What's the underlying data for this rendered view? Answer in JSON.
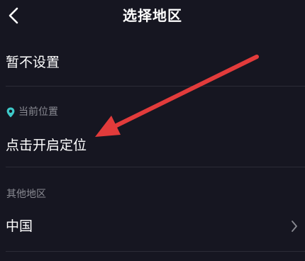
{
  "header": {
    "title": "选择地区"
  },
  "options": {
    "not_set_label": "暂不设置"
  },
  "current_location": {
    "section_label": "当前位置",
    "enable_label": "点击开启定位"
  },
  "other_regions": {
    "section_label": "其他地区",
    "items": [
      {
        "label": "中国"
      }
    ]
  },
  "colors": {
    "background": "#161621",
    "text": "#ffffff",
    "secondary_text": "#8a8b93",
    "divider": "#2b2b36",
    "location_pin": "#3ec9c9",
    "annotation_arrow": "#e23b3b"
  },
  "icons": {
    "back": "chevron-left-icon",
    "location": "location-pin-icon",
    "item_chevron": "chevron-right-icon"
  }
}
